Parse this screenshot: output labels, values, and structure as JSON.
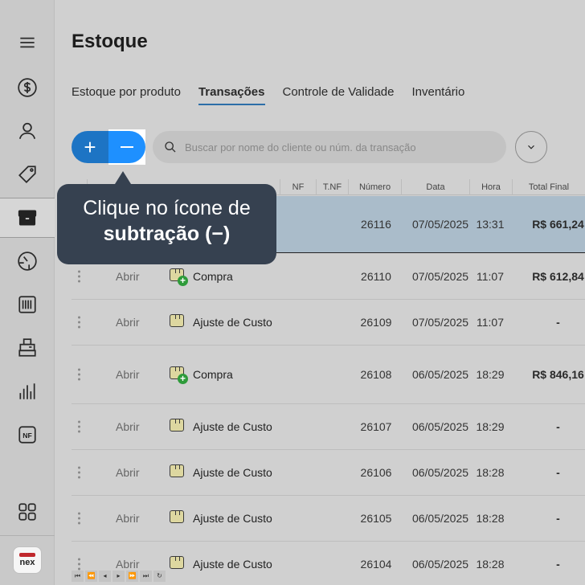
{
  "sidebar": {
    "items": [
      {
        "name": "menu-icon"
      },
      {
        "name": "dollar-icon"
      },
      {
        "name": "user-icon"
      },
      {
        "name": "tag-icon"
      },
      {
        "name": "box-icon",
        "active": true
      },
      {
        "name": "gauge-icon"
      },
      {
        "name": "barcode-icon"
      },
      {
        "name": "register-icon"
      },
      {
        "name": "bar-chart-icon"
      },
      {
        "name": "nf-icon",
        "label": "NF"
      },
      {
        "name": "apps-grid-icon"
      }
    ],
    "logo_text": "nex"
  },
  "page": {
    "title": "Estoque",
    "tabs": [
      {
        "label": "Estoque por produto",
        "active": false
      },
      {
        "label": "Transações",
        "active": true
      },
      {
        "label": "Controle de Validade",
        "active": false
      },
      {
        "label": "Inventário",
        "active": false
      }
    ]
  },
  "toolbar": {
    "add_label": "+",
    "search_placeholder": "Buscar por nome do cliente ou núm. da transação"
  },
  "table": {
    "headers": {
      "nf": "NF",
      "tnf": "T.NF",
      "numero": "Número",
      "data": "Data",
      "hora": "Hora",
      "total": "Total Final"
    },
    "rows": [
      {
        "numero": "26116",
        "data": "07/05/2025",
        "hora": "13:31",
        "total": "R$ 661,24"
      },
      {
        "abrir": "Abrir",
        "tipo": "Compra",
        "numero": "26110",
        "data": "07/05/2025",
        "hora": "11:07",
        "total": "R$ 612,84"
      },
      {
        "abrir": "Abrir",
        "tipo": "Ajuste de Custo",
        "numero": "26109",
        "data": "07/05/2025",
        "hora": "11:07",
        "total": "-"
      },
      {
        "abrir": "Abrir",
        "tipo": "Compra",
        "numero": "26108",
        "data": "06/05/2025",
        "hora": "18:29",
        "total": "R$ 846,16"
      },
      {
        "abrir": "Abrir",
        "tipo": "Ajuste de Custo",
        "numero": "26107",
        "data": "06/05/2025",
        "hora": "18:29",
        "total": "-"
      },
      {
        "abrir": "Abrir",
        "tipo": "Ajuste de Custo",
        "numero": "26106",
        "data": "06/05/2025",
        "hora": "18:28",
        "total": "-"
      },
      {
        "abrir": "Abrir",
        "tipo": "Ajuste de Custo",
        "numero": "26105",
        "data": "06/05/2025",
        "hora": "18:28",
        "total": "-"
      },
      {
        "abrir": "Abrir",
        "tipo": "Ajuste de Custo",
        "numero": "26104",
        "data": "06/05/2025",
        "hora": "18:28",
        "total": "-"
      }
    ]
  },
  "tooltip": {
    "line1": "Clique no ícone de",
    "line2": "subtração (−)"
  },
  "colors": {
    "accent": "#1e90ff",
    "add_button": "#1d74c4",
    "tooltip_bg": "#364150",
    "selected_row": "#aabcca",
    "badge_green": "#2e9b3a"
  }
}
